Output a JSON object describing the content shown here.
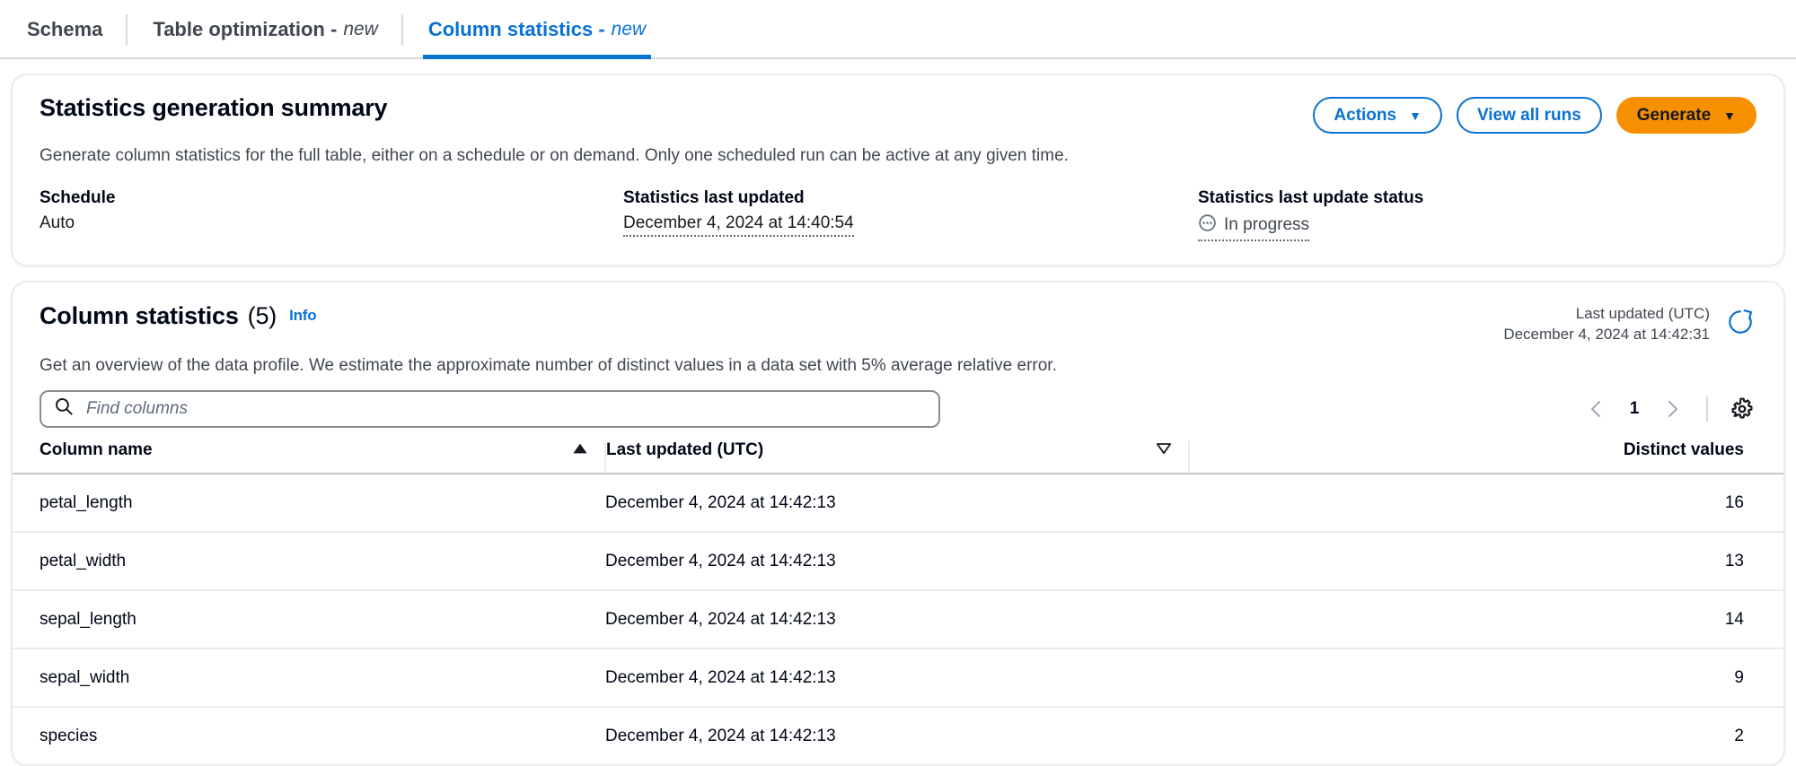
{
  "tabs": [
    {
      "label": "Schema",
      "suffix": "",
      "active": false,
      "name": "tab-schema"
    },
    {
      "label": "Table optimization -",
      "suffix": "new",
      "active": false,
      "name": "tab-table-optimization"
    },
    {
      "label": "Column statistics -",
      "suffix": "new",
      "active": true,
      "name": "tab-column-statistics"
    }
  ],
  "summary": {
    "title": "Statistics generation summary",
    "description": "Generate column statistics for the full table, either on a schedule or on demand. Only one scheduled run can be active at any given time.",
    "actions_label": "Actions",
    "view_all_runs_label": "View all runs",
    "generate_label": "Generate",
    "caret_glyph": "▼",
    "fields": [
      {
        "label": "Schedule",
        "value": "Auto",
        "dotted": false,
        "icon": ""
      },
      {
        "label": "Statistics last updated",
        "value": "December 4, 2024 at 14:40:54",
        "dotted": true,
        "icon": ""
      },
      {
        "label": "Statistics last update status",
        "value": "In progress",
        "dotted": true,
        "icon": "in-progress-icon"
      }
    ]
  },
  "table_section": {
    "title": "Column statistics",
    "count": "(5)",
    "info_label": "Info",
    "description": "Get an overview of the data profile. We estimate the approximate number of distinct values in a data set with 5% average relative error.",
    "last_updated_label": "Last updated (UTC)",
    "last_updated_value": "December 4, 2024 at 14:42:31",
    "search_placeholder": "Find columns",
    "search_value": "",
    "pagination": {
      "prev_glyph": "‹",
      "page": "1",
      "next_glyph": "›"
    },
    "columns": [
      {
        "header": "Column name",
        "sort": "asc-active",
        "align": "left"
      },
      {
        "header": "Last updated (UTC)",
        "sort": "desc-inactive",
        "align": "left"
      },
      {
        "header": "Distinct values",
        "sort": "none",
        "align": "right"
      }
    ],
    "rows": [
      {
        "column_name": "petal_length",
        "last_updated": "December 4, 2024 at 14:42:13",
        "distinct_values": "16"
      },
      {
        "column_name": "petal_width",
        "last_updated": "December 4, 2024 at 14:42:13",
        "distinct_values": "13"
      },
      {
        "column_name": "sepal_length",
        "last_updated": "December 4, 2024 at 14:42:13",
        "distinct_values": "14"
      },
      {
        "column_name": "sepal_width",
        "last_updated": "December 4, 2024 at 14:42:13",
        "distinct_values": "9"
      },
      {
        "column_name": "species",
        "last_updated": "December 4, 2024 at 14:42:13",
        "distinct_values": "2"
      }
    ]
  },
  "colors": {
    "link_blue": "#0972d3",
    "primary_orange": "#f79000",
    "text_primary": "#000716",
    "text_secondary": "#414750",
    "border": "#e9ebed"
  }
}
